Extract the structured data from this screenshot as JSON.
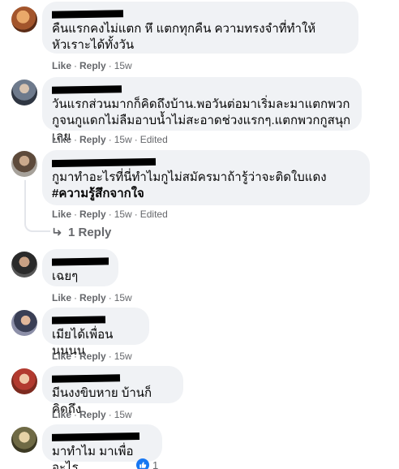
{
  "actions": {
    "like": "Like",
    "reply": "Reply",
    "separator": "·"
  },
  "comments": [
    {
      "text": "คืนแรกคงไม่แตก หึ แตกทุกคืน ความทรงจำที่ทำให้หัวเราะได้ทั้งวัน",
      "time": "15w",
      "edited": ""
    },
    {
      "text": "วันแรกส่วนมากก็คิดถึงบ้าน.พอวันต่อมาเริ่มละมาแตกพวกกูจนกูแดกไม่ลืมอาบน้ำไม่สะอาดช่วงแรกๆ.แตกพวกกูสนุกเลย",
      "time": "15w",
      "edited": "Edited"
    },
    {
      "text": "กูมาทำอะไรที่นี่ทำไมกูไม่สมัครมาถ้ารู้ว่าจะติดใบแดง ",
      "hashtag": "#ความรู้สึกจากใจ",
      "time": "15w",
      "edited": "Edited",
      "replies_label": "1 Reply"
    },
    {
      "text": "เฉยๆ",
      "time": "15w",
      "edited": ""
    },
    {
      "text": "เมียได้เพื่อนนนนน",
      "time": "15w",
      "edited": ""
    },
    {
      "text": "มีนงงขิบหาย บ้านก็คิดถึง",
      "time": "15w",
      "edited": ""
    },
    {
      "text": "มาทำไม มาเพื่ออะไร",
      "time": "",
      "edited": "",
      "reactions": "1"
    }
  ],
  "colors": {
    "bubble": "#f0f2f5",
    "meta": "#65676b",
    "like_blue": "#1877f2"
  }
}
